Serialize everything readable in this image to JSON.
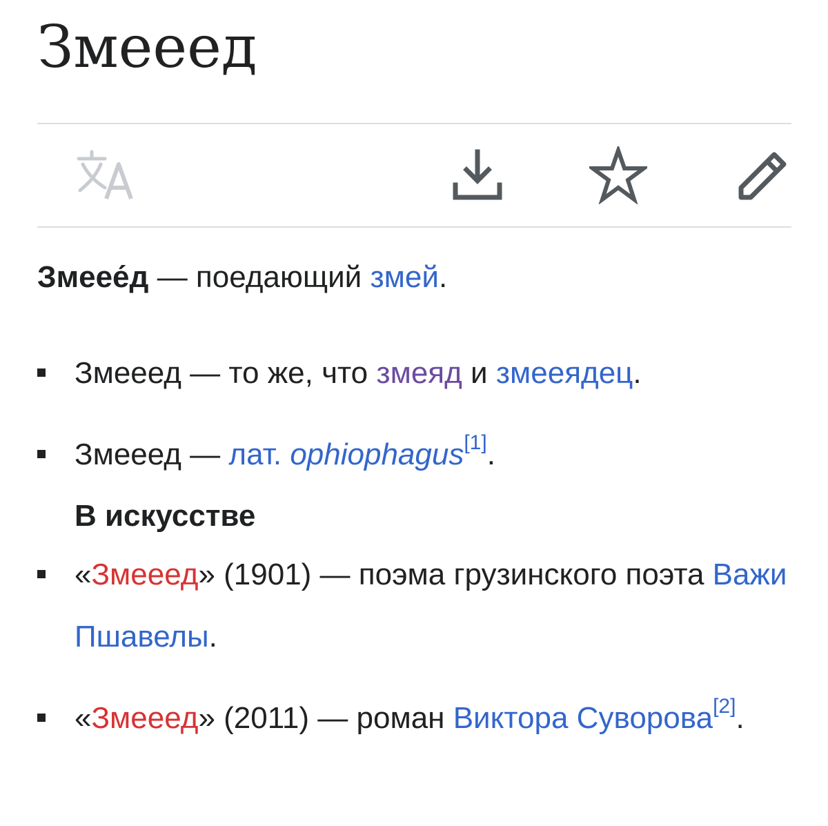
{
  "page": {
    "title": "Змееед"
  },
  "toolbar": {
    "language_icon": "translate-icon",
    "download_icon": "download-icon",
    "star_icon": "star-outline-icon",
    "edit_icon": "pencil-icon",
    "active_color": "#54595d",
    "disabled_color": "#c8ccd1"
  },
  "lead": {
    "term": "Змеее́д",
    "dash": " — поедающий ",
    "link": "змей",
    "end": "."
  },
  "items": [
    {
      "pre": "Змееед — то же, что ",
      "link1": "змеяд",
      "mid": " и ",
      "link2": "змееядец",
      "end": "."
    },
    {
      "pre": "Змееед — ",
      "link_abbr": "лат.",
      "link_word": "ophiophagus",
      "ref": "[1]",
      "end": "."
    }
  ],
  "section_heading": "В искусстве",
  "art_items": [
    {
      "open": "«",
      "title_link": "Змееед",
      "close": "» (1901) — поэма грузинского поэта ",
      "author_link": "Важи Пшавелы",
      "end": "."
    },
    {
      "open": "«",
      "title_link": "Змееед",
      "close": "» (2011) — роман ",
      "author_link": "Виктора Суворова",
      "ref": "[2]",
      "end": "."
    }
  ],
  "colors": {
    "link": "#3366cc",
    "visited_link": "#6b4ba1",
    "red_link": "#d73333",
    "text": "#202122"
  }
}
